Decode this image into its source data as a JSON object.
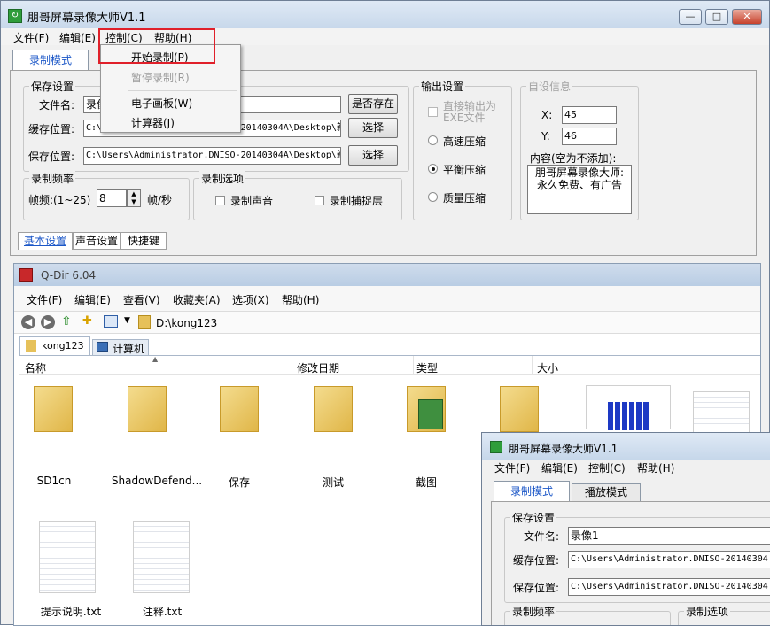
{
  "main_window": {
    "title": "朋哥屏幕录像大师V1.1",
    "menu": [
      "文件(F)",
      "编辑(E)",
      "控制(C)",
      "帮助(H)"
    ],
    "tab_record": "录制模式",
    "save_settings": {
      "group": "保存设置",
      "filename_label": "文件名:",
      "filename_value": "录像1",
      "exists_button": "是否存在",
      "cache_label": "缓存位置:",
      "cache_value": "C:\\Users\\Administrator.DNISO-20140304A\\Desktop\\新",
      "save_label": "保存位置:",
      "save_value": "C:\\Users\\Administrator.DNISO-20140304A\\Desktop\\新",
      "choose_button": "选择"
    },
    "freq": {
      "group": "录制频率",
      "label": "帧频:(1~25)",
      "value": "8",
      "unit": "帧/秒"
    },
    "options": {
      "group": "录制选项",
      "sound": "录制声音",
      "capture_layer": "录制捕捉层"
    },
    "output": {
      "group": "输出设置",
      "exe": "直接输出为\nEXE文件",
      "high": "高速压缩",
      "balance": "平衡压缩",
      "quality": "质量压缩"
    },
    "custom": {
      "group": "自设信息",
      "x_label": "X:",
      "x_value": "45",
      "y_label": "Y:",
      "y_value": "46",
      "content_label": "内容(空为不添加):",
      "content_value": "朋哥屏幕录像大师:\n永久免费、有广告"
    },
    "bottom_tabs": [
      "基本设置",
      "声音设置",
      "快捷键"
    ],
    "control_menu": {
      "start": "开始录制(P)",
      "pause": "暂停录制(R)",
      "board": "电子画板(W)",
      "calc": "计算器(J)"
    }
  },
  "qdir": {
    "title": "Q-Dir 6.04",
    "menu": [
      "文件(F)",
      "编辑(E)",
      "查看(V)",
      "收藏夹(A)",
      "选项(X)",
      "帮助(H)"
    ],
    "path": "D:\\kong123",
    "tabs": [
      "kong123",
      "计算机"
    ],
    "columns": [
      "名称",
      "修改日期",
      "类型",
      "大小"
    ],
    "files": [
      "SD1cn",
      "ShadowDefend...",
      "保存",
      "测试",
      "截图",
      "提示说明.txt",
      "注释.txt"
    ]
  },
  "inner_window": {
    "title": "朋哥屏幕录像大师V1.1",
    "menu": [
      "文件(F)",
      "编辑(E)",
      "控制(C)",
      "帮助(H)"
    ],
    "tabs": [
      "录制模式",
      "播放模式"
    ],
    "group": "保存设置",
    "filename_label": "文件名:",
    "filename_value": "录像1",
    "cache_label": "缓存位置:",
    "cache_value": "C:\\Users\\Administrator.DNISO-20140304",
    "save_label": "保存位置:",
    "save_value": "C:\\Users\\Administrator.DNISO-20140304",
    "freq_group": "录制频率",
    "options_group": "录制选项"
  },
  "colors": {
    "highlight_box": "#e0202a",
    "link_blue": "#1a56c7"
  }
}
